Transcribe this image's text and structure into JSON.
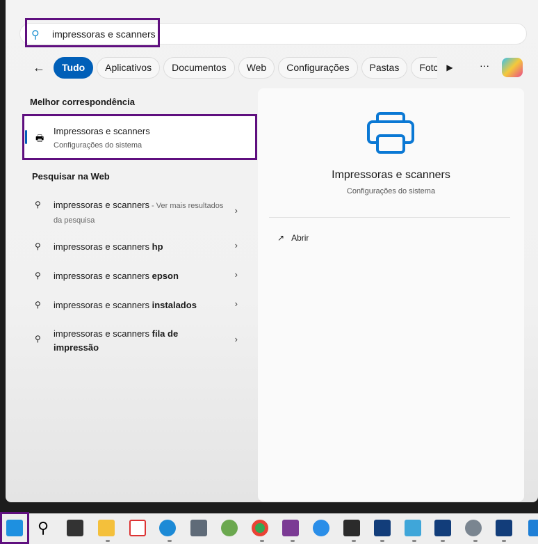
{
  "search": {
    "query": "impressoras e scanners"
  },
  "tabs": [
    "Tudo",
    "Aplicativos",
    "Documentos",
    "Web",
    "Configurações",
    "Pastas",
    "Fotc"
  ],
  "more_label": "···",
  "best_match": {
    "heading": "Melhor correspondência",
    "title": "Impressoras e scanners",
    "subtitle": "Configurações do sistema"
  },
  "web": {
    "heading": "Pesquisar na Web",
    "items": [
      {
        "text": "impressoras e scanners",
        "extra": " - Ver mais resultados da pesquisa"
      },
      {
        "text": "impressoras e scanners ",
        "bold": "hp"
      },
      {
        "text": "impressoras e scanners ",
        "bold": "epson"
      },
      {
        "text": "impressoras e scanners ",
        "bold": "instalados"
      },
      {
        "text": "impressoras e scanners ",
        "bold": "fila de impressão"
      }
    ]
  },
  "preview": {
    "title": "Impressoras e scanners",
    "subtitle": "Configurações do sistema",
    "open_label": "Abrir"
  },
  "colors": {
    "accent": "#005fb8",
    "highlight": "#5f0f7f"
  }
}
